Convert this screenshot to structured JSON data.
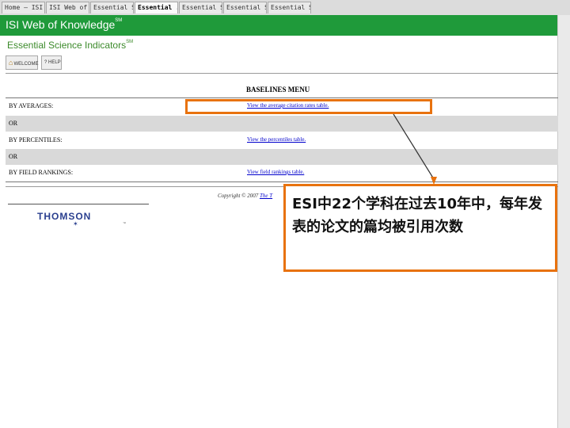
{
  "browser": {
    "tabs": [
      {
        "label": "Home — ISI ..."
      },
      {
        "label": "ISI Web of K..."
      },
      {
        "label": "Essential Sc..."
      },
      {
        "label": "Essential ..."
      },
      {
        "label": "Essential Sc..."
      },
      {
        "label": "Essential Sc..."
      },
      {
        "label": "Essential Sc..."
      }
    ],
    "active_tab": 3
  },
  "header": {
    "title": "ISI Web of Knowledge",
    "title_mark": "SM",
    "subtitle": "Essential Science Indicators",
    "subtitle_mark": "SM"
  },
  "toolbar": {
    "welcome_label": "WELCOME",
    "help_label": "? HELP"
  },
  "menu": {
    "title": "BASELINES MENU",
    "rows": [
      {
        "label": "BY AVERAGES:",
        "link": "View the average citation rates table."
      },
      {
        "label": "OR",
        "link": ""
      },
      {
        "label": "BY PERCENTILES:",
        "link": "View the percentiles table."
      },
      {
        "label": "OR",
        "link": ""
      },
      {
        "label": "BY FIELD RANKINGS:",
        "link": "View field rankings table."
      }
    ]
  },
  "footer": {
    "copyright": "Copyright © 2007 ",
    "copyright_link": "The T",
    "logo": "THOMSON",
    "logo_tm": "™"
  },
  "annotation": {
    "callout_text": "ESI中22个学科在过去10年中，每年发表的论文的篇均被引用次数",
    "color": "#e8720e"
  }
}
